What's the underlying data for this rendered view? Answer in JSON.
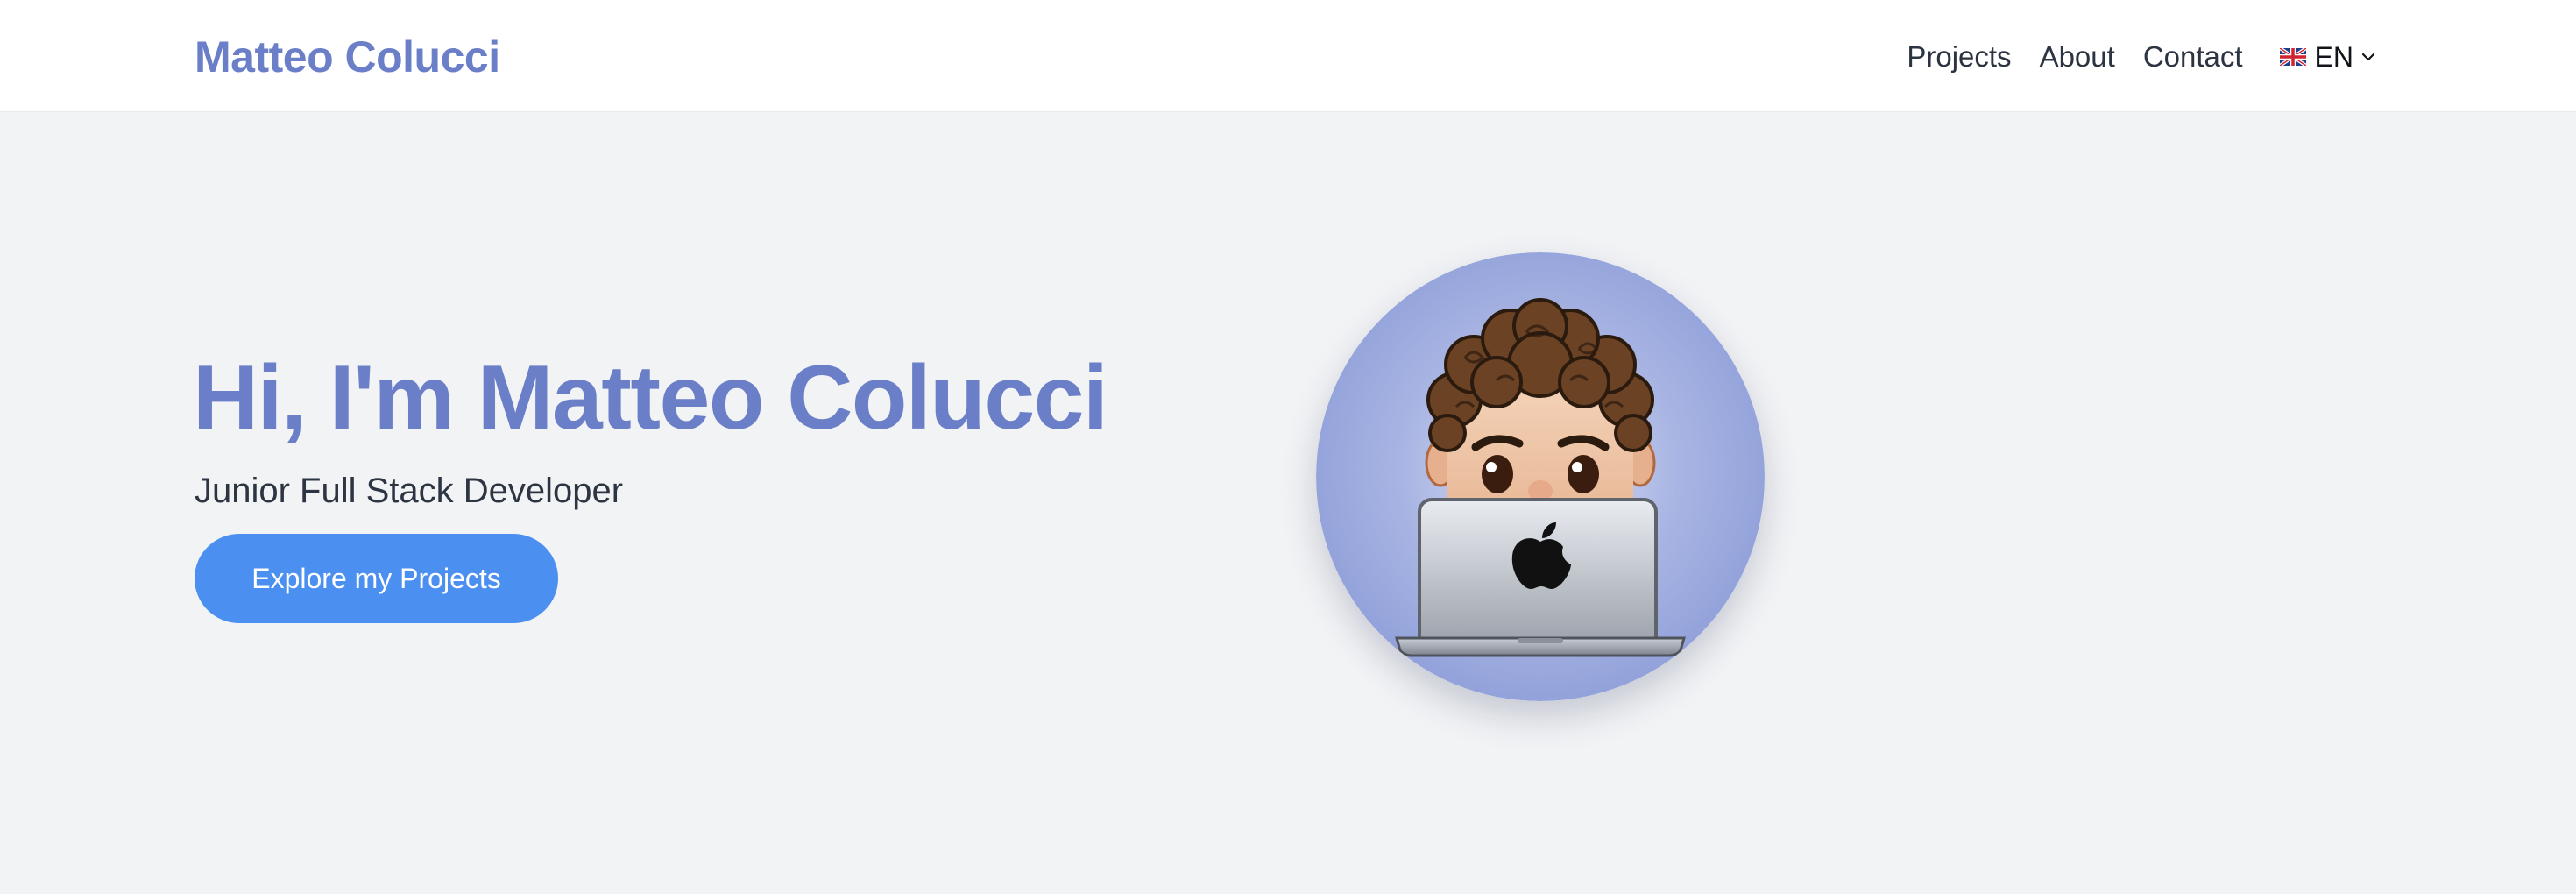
{
  "header": {
    "brand": "Matteo Colucci",
    "nav": [
      {
        "label": "Projects"
      },
      {
        "label": "About"
      },
      {
        "label": "Contact"
      }
    ],
    "language": {
      "code": "EN",
      "flag_icon": "uk-flag-icon",
      "dropdown_icon": "chevron-down-icon"
    }
  },
  "hero": {
    "title": "Hi, I'm Matteo Colucci",
    "subtitle": "Junior Full Stack Developer",
    "cta_label": "Explore my Projects",
    "avatar_icon": "memoji-avatar-with-laptop"
  },
  "colors": {
    "brand": "#6b7fc8",
    "cta": "#4b8ff1",
    "background": "#f2f3f5",
    "header_bg": "#ffffff",
    "avatar_circle": "#96a5dc"
  }
}
